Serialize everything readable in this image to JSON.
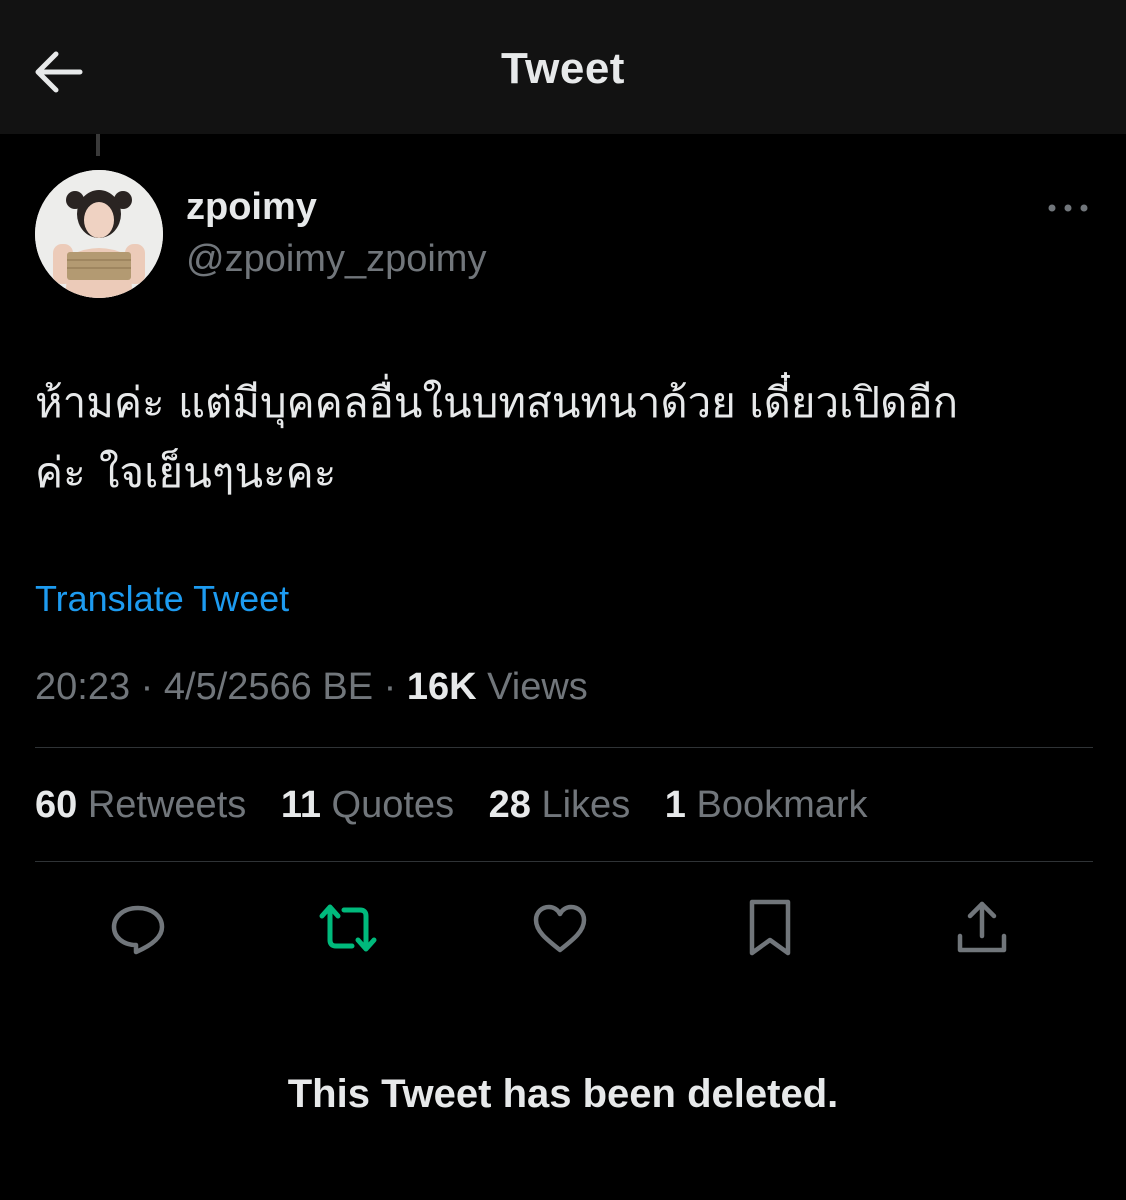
{
  "header": {
    "title": "Tweet",
    "back_icon": "arrow-left-icon"
  },
  "author": {
    "display_name": "zpoimy",
    "handle": "@zpoimy_zpoimy",
    "avatar_icon": "profile-photo"
  },
  "more_icon": "ellipsis-icon",
  "tweet": {
    "text_line_1": "ห้ามค่ะ แต่มีบุคคลอื่นในบทสนทนาด้วย เดี๋ยวเปิดอีก",
    "text_line_2": "ค่ะ ใจเย็นๆนะคะ",
    "translate_label": "Translate Tweet",
    "time": "20:23",
    "separator": "·",
    "date": "4/5/2566 BE",
    "views_count": "16K",
    "views_label": "Views"
  },
  "stats": [
    {
      "count": "60",
      "label": "Retweets"
    },
    {
      "count": "11",
      "label": "Quotes"
    },
    {
      "count": "28",
      "label": "Likes"
    },
    {
      "count": "1",
      "label": "Bookmark"
    }
  ],
  "actions": [
    {
      "icon": "reply-icon"
    },
    {
      "icon": "retweet-icon",
      "color": "#00ba7c"
    },
    {
      "icon": "like-icon"
    },
    {
      "icon": "bookmark-icon"
    },
    {
      "icon": "share-icon"
    }
  ],
  "colors": {
    "background": "#000000",
    "header_background": "#121212",
    "text_primary": "#e7e9ea",
    "text_secondary": "#71767b",
    "link": "#1d9bf0",
    "retweet_active": "#00ba7c",
    "divider": "#2f3336"
  },
  "notice": "This Tweet has been deleted."
}
